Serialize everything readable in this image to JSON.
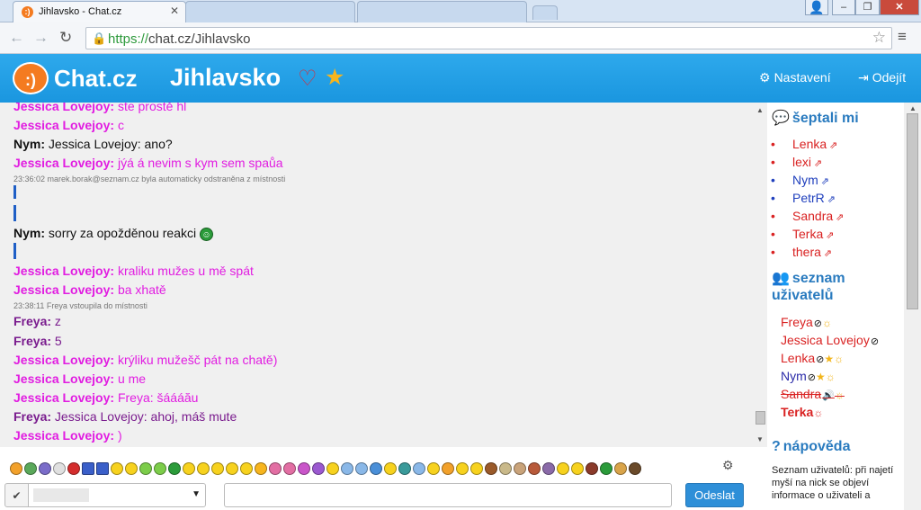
{
  "browser": {
    "tab_title": "Jihlavsko - Chat.cz",
    "url_scheme": "https://",
    "url_rest": "chat.cz/Jihlavsko"
  },
  "header": {
    "logo_text": "Chat.cz",
    "room": "Jihlavsko",
    "settings": "Nastavení",
    "leave": "Odejít"
  },
  "messages": [
    {
      "nick": "Jessica Lovejoy:",
      "text": " ste prostě hl",
      "color": "pink"
    },
    {
      "nick": "Jessica Lovejoy:",
      "text": " c",
      "color": "pink"
    },
    {
      "nick": "Nym:",
      "text": " Jessica Lovejoy: ano?",
      "color": "black"
    },
    {
      "nick": "Jessica Lovejoy:",
      "text": " jýá á nevim s kym sem spaůa",
      "color": "pink"
    },
    {
      "system": "23:36:02 marek.borak@seznam.cz byla automaticky odstraněna z místnosti"
    },
    {
      "nick": "Nym:",
      "text": " sorry za opožděnou reakci",
      "color": "black"
    },
    {
      "nick": "Jessica Lovejoy:",
      "text": " kraliku mužes u mě spát",
      "color": "pink"
    },
    {
      "nick": "Jessica Lovejoy:",
      "text": " ba xhatě",
      "color": "pink"
    },
    {
      "system": "23:38:11 Freya vstoupila do místnosti"
    },
    {
      "nick": "Freya:",
      "text": " z",
      "color": "purple"
    },
    {
      "nick": "Freya:",
      "text": " 5",
      "color": "purple"
    },
    {
      "nick": "Jessica Lovejoy:",
      "text": " krýliku mužešč pát na chatě)",
      "color": "pink"
    },
    {
      "nick": "Jessica Lovejoy:",
      "text": " u me",
      "color": "pink"
    },
    {
      "nick": "Jessica Lovejoy:",
      "text": " Freya: šáááău",
      "color": "pink"
    },
    {
      "nick": "Freya:",
      "text": " Jessica Lovejoy: ahoj, máš mute",
      "color": "purple"
    },
    {
      "nick": "Jessica Lovejoy:",
      "text": " )",
      "color": "pink"
    }
  ],
  "sidebar": {
    "whispers_title": "šeptali mi",
    "whispers": [
      {
        "name": "Lenka",
        "color": "#d92222"
      },
      {
        "name": "lexi",
        "color": "#d92222"
      },
      {
        "name": "Nym",
        "color": "#1f3fbd"
      },
      {
        "name": "PetrR",
        "color": "#1f3fbd"
      },
      {
        "name": "Sandra",
        "color": "#d92222"
      },
      {
        "name": "Terka",
        "color": "#d92222"
      },
      {
        "name": "thera",
        "color": "#d92222"
      }
    ],
    "users_title_1": "seznam",
    "users_title_2": "uživatelů",
    "users": [
      {
        "name": "Freya"
      },
      {
        "name": "Jessica Lovejoy"
      },
      {
        "name": "Lenka"
      },
      {
        "name": "Nym"
      },
      {
        "name": "Sandra"
      },
      {
        "name": "Terka"
      }
    ],
    "help_title": "nápověda",
    "help_text": "Seznam uživatelů: při najetí myší na nick se objeví informace o uživateli a"
  },
  "input": {
    "send_label": "Odeslat"
  },
  "colors": {
    "header_blue": "#1a96df",
    "nick_pink": "#e11de1",
    "nick_purple": "#7a1c8e",
    "side_red": "#d92222",
    "side_blue": "#1f3fbd"
  }
}
